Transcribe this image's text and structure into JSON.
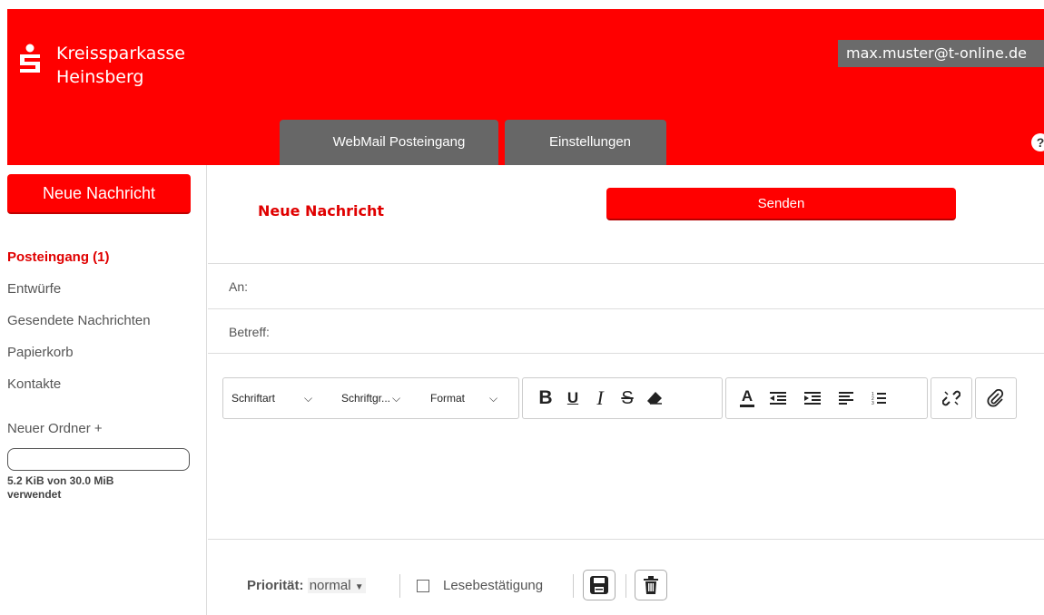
{
  "header": {
    "brand": {
      "line1": "Kreissparkasse",
      "line2": "Heinsberg"
    },
    "user_email": "max.muster@t-online.de",
    "tabs": [
      {
        "label": "WebMail Posteingang"
      },
      {
        "label": "Einstellungen"
      }
    ],
    "help_label": "?",
    "brand_color": "#ff0000"
  },
  "sidebar": {
    "new_message_label": "Neue Nachricht",
    "folders": [
      {
        "label": "Posteingang (1)",
        "active": true
      },
      {
        "label": "Entwürfe"
      },
      {
        "label": "Gesendete Nachrichten"
      },
      {
        "label": "Papierkorb"
      },
      {
        "label": "Kontakte"
      }
    ],
    "new_folder_label": "Neuer Ordner +",
    "quota": {
      "used_fraction": 0.0002,
      "text": "5.2 KiB von 30.0 MiB verwendet"
    }
  },
  "compose": {
    "title": "Neue Nachricht",
    "send_label": "Senden",
    "to_label": "An:",
    "to_value": "",
    "subject_label": "Betreff:",
    "subject_value": "",
    "toolbar": {
      "font_label": "Schriftart",
      "size_label": "Schriftgr...",
      "format_label": "Format",
      "icons": [
        "bold-icon",
        "underline-icon",
        "italic-icon",
        "strikethrough-icon",
        "eraser-icon",
        "text-color-icon",
        "outdent-icon",
        "indent-icon",
        "align-left-icon",
        "ordered-list-icon",
        "unlink-icon",
        "attachment-icon"
      ]
    },
    "footer": {
      "priority_label": "Priorität:",
      "priority_value": "normal",
      "read_receipt_label": "Lesebestätigung",
      "icons": [
        "save-icon",
        "trash-icon"
      ]
    }
  }
}
